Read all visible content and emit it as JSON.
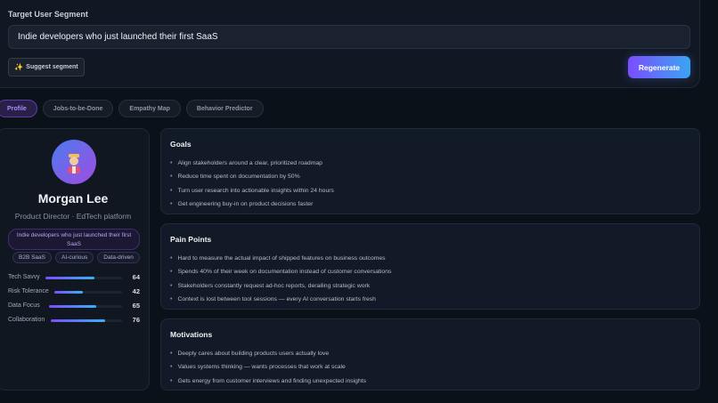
{
  "segment": {
    "label": "Target User Segment",
    "value": "Indie developers who just launched their first SaaS",
    "suggest_label": "Suggest segment",
    "regenerate_label": "Regenerate"
  },
  "tabs": [
    {
      "label": "Profile",
      "active": true
    },
    {
      "label": "Jobs-to-be-Done",
      "active": false
    },
    {
      "label": "Empathy Map",
      "active": false
    },
    {
      "label": "Behavior Predictor",
      "active": false
    }
  ],
  "persona": {
    "avatar_icon": "person-avatar-icon",
    "name": "Morgan Lee",
    "role": "Product Director · EdTech platform",
    "segment_chip": "Indie developers who just launched their first SaaS",
    "tags": [
      "B2B SaaS",
      "AI-curious",
      "Data-driven"
    ],
    "stats": [
      {
        "label": "Tech Savvy",
        "value": 64
      },
      {
        "label": "Risk Tolerance",
        "value": 42
      },
      {
        "label": "Data Focus",
        "value": 65
      },
      {
        "label": "Collaboration",
        "value": 76
      }
    ]
  },
  "sections": {
    "goals": {
      "title": "Goals",
      "items": [
        "Align stakeholders around a clear, prioritized roadmap",
        "Reduce time spent on documentation by 50%",
        "Turn user research into actionable insights within 24 hours",
        "Get engineering buy-in on product decisions faster"
      ]
    },
    "pain_points": {
      "title": "Pain Points",
      "items": [
        "Hard to measure the actual impact of shipped features on business outcomes",
        "Spends 40% of their week on documentation instead of customer conversations",
        "Stakeholders constantly request ad-hoc reports, derailing strategic work",
        "Context is lost between tool sessions — every AI conversation starts fresh"
      ]
    },
    "motivations": {
      "title": "Motivations",
      "items": [
        "Deeply cares about building products users actually love",
        "Values systems thinking — wants processes that work at scale",
        "Gets energy from customer interviews and finding unexpected insights"
      ]
    }
  },
  "colors": {
    "accent_purple": "#7b4dff",
    "accent_blue": "#3aa5f2",
    "background": "#0b1119"
  }
}
